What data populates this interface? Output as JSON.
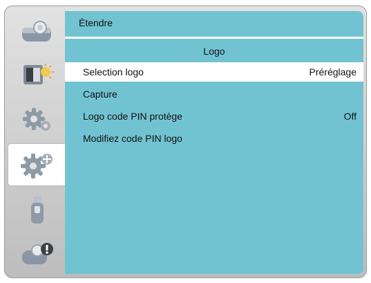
{
  "sidebar": {
    "items": [
      {
        "icon": "projector-icon"
      },
      {
        "icon": "image-settings-icon"
      },
      {
        "icon": "settings-gear-icon"
      },
      {
        "icon": "extended-settings-icon",
        "active": true
      },
      {
        "icon": "usb-memory-icon"
      },
      {
        "icon": "info-icon"
      }
    ]
  },
  "panel": {
    "title": "Étendre",
    "subtitle": "Logo",
    "rows": [
      {
        "label": "Selection logo",
        "value": "Préréglage",
        "selected": true
      },
      {
        "label": "Capture",
        "value": ""
      },
      {
        "label": "Logo code PIN protège",
        "value": "Off"
      },
      {
        "label": "Modifiez code PIN logo",
        "value": ""
      }
    ]
  },
  "colors": {
    "panel_bg": "#72c3d1",
    "selected_row": "#ffffff",
    "frame": "#cfcfcf"
  }
}
